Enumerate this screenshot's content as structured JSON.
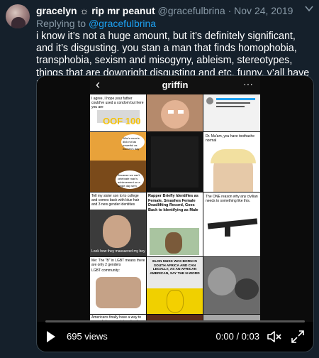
{
  "tweet": {
    "display_name": "gracelyn ☼ rip mr peanut",
    "handle": "@gracefulbrina",
    "separator": "·",
    "date": "Nov 24, 2019",
    "replying_to_prefix": "Replying to",
    "replying_to_handle": "@gracefulbrina",
    "text": "i know it’s not a huge amount, but it’s definitely significant, and it’s disgusting. you stan a man that finds homophobia, transphobia, sexism and misogyny, ableism, stereotypes, things that are downright disgusting and etc. funny. y’all have been ignoring this too much."
  },
  "video": {
    "phone_back": "‹",
    "phone_title": "griffin",
    "phone_more": "···",
    "tiles": {
      "t1": "I agree, I hope your father could've used a condom but here you are",
      "t2": "OOF 100",
      "t3": "Who's mom's dick not as powerful as women's day",
      "t4": "Because we can't celebrate man's achievement on a single day smh",
      "t5": "Tell my sister son to to college and comes back with blue hair and 3 new gender identities",
      "t6": "Look how they massacred my boy",
      "t7": "Rapper Briefly Identifies as Female, Smashes Female Deadlifting Record, Goes Back to Identifying as Male",
      "t8": "Me: The \"B\" in LGBT means there are only 2 genders",
      "t9": "LGBT community:",
      "t10": "ELON MUSK WAS BORN IN SOUTH AFRICA AND CAN LEGALLY, AS AN AFRICAN AMERICAN, SAY THE N-WORD",
      "t11": "The ONE reason why any civilian needs to something like this.",
      "t12": "Americans finally have a way to smuggle bananas into school",
      "t13": "Dr. Ma'am, you have toothache normal"
    },
    "views": "695 views",
    "time": "0:00 / 0:03"
  },
  "colors": {
    "background": "#15202b",
    "muted": "#8899a6",
    "link": "#1da1f2"
  }
}
